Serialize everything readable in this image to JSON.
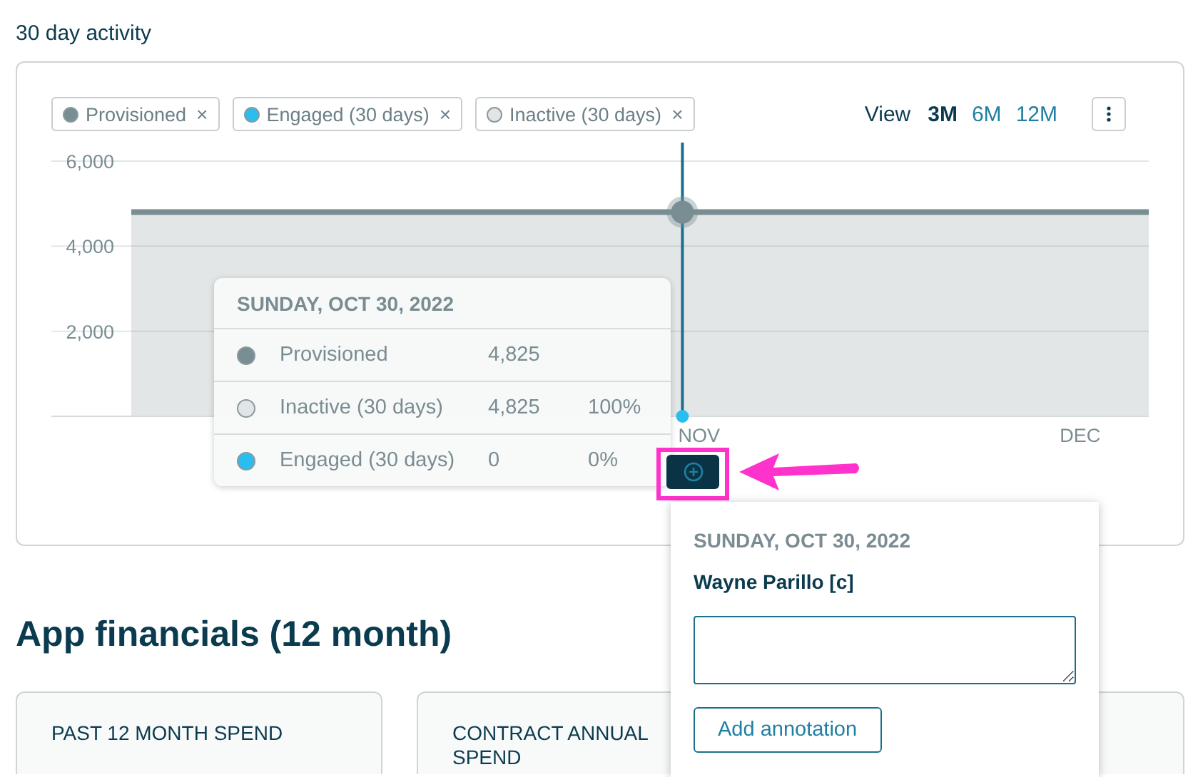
{
  "section_title": "30 day activity",
  "activity": {
    "filters": [
      {
        "color": "#798e93",
        "remove": "×"
      },
      {
        "label": "Engaged (30 days)",
        "color": "#2bbdf0",
        "remove": "×"
      },
      {
        "label": "Inactive (30 days)",
        "color": "#e1e5e6",
        "remove": "×"
      }
    ],
    "view_label": "View",
    "ranges": [
      {
        "label": "3M",
        "selected": true
      },
      {
        "label": "6M",
        "selected": false
      },
      {
        "label": "12M",
        "selected": false
      }
    ],
    "chart_data": {
      "type": "area",
      "ylim": [
        0,
        6000
      ],
      "categories": [
        null,
        null,
        null,
        null,
        null,
        null,
        null,
        null,
        null,
        null,
        null,
        null,
        null,
        "NOV",
        null,
        null,
        null,
        null,
        null,
        null,
        null,
        null,
        "DEC",
        null,
        null
      ],
      "yticks": [
        {
          "value": 2000,
          "label": "2,000"
        },
        {
          "value": 4000,
          "label": "4,000"
        },
        {
          "value": 6000,
          "label": "6,000"
        }
      ],
      "series": [
        {
          "name": "Provisioned",
          "color": "#798e93",
          "values": [
            4800,
            4800,
            4800,
            4800,
            4800,
            4800,
            4800,
            4800,
            4800,
            4800,
            4800,
            4800,
            4800,
            4800,
            4800,
            4800,
            4800,
            4800,
            4800,
            4800,
            4800,
            4800,
            4800,
            4800,
            4800
          ]
        }
      ]
    },
    "tooltip": {
      "title": "SUNDAY, OCT 30, 2022",
      "rows": [
        {
          "name": "Provisioned",
          "color": "#798e93",
          "value": "4,825"
        },
        {
          "name": "Inactive (30 days)",
          "color": "#e1e5e6",
          "value": "4,825",
          "percent": "100%"
        },
        {
          "name": "Engaged (30 days)",
          "color": "#2bbdf0",
          "value": "0",
          "percent": "0%"
        }
      ]
    }
  },
  "annotation_popup": {
    "date": "SUNDAY, OCT 30, 2022",
    "author": "Wayne Parillo [c]",
    "button": "Add annotation"
  },
  "financials": {
    "title": "App financials (12 month)",
    "cards": [
      {
        "label": "PAST 12 MONTH SPEND"
      },
      {
        "label": "CONTRACT ANNUAL SPEND"
      }
    ]
  }
}
